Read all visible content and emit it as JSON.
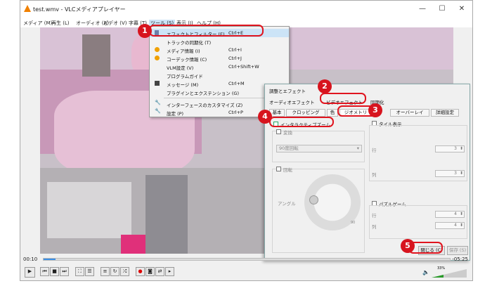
{
  "window": {
    "title": "test.wmv - VLCメディアプレイヤー"
  },
  "menubar": [
    {
      "label": "メディア (M)"
    },
    {
      "label": "再生 (L)"
    },
    {
      "label": "オーディオ (A)"
    },
    {
      "label": "ビデオ (V)"
    },
    {
      "label": "字幕 (T)"
    },
    {
      "label": "ツール (S)"
    },
    {
      "label": "表示 (I)"
    },
    {
      "label": "ヘルプ (H)"
    }
  ],
  "tools_menu": {
    "items": [
      {
        "label": "エフェクトとフィルター (E)",
        "shortcut": "Ctrl+E"
      },
      {
        "label": "トラックの同期化 (T)",
        "shortcut": ""
      },
      {
        "label": "メディア情報 (I)",
        "shortcut": "Ctrl+I"
      },
      {
        "label": "コーデック情報 (C)",
        "shortcut": "Ctrl+J"
      },
      {
        "label": "VLM設定 (V)",
        "shortcut": "Ctrl+Shift+W"
      },
      {
        "label": "プログラムガイド",
        "shortcut": ""
      },
      {
        "label": "メッセージ (M)",
        "shortcut": "Ctrl+M"
      },
      {
        "label": "プラグインとエクステンション (G)",
        "shortcut": ""
      },
      {
        "label": "インターフェースのカスタマイズ (Z)",
        "shortcut": ""
      },
      {
        "label": "設定 (P)",
        "shortcut": "Ctrl+P"
      }
    ]
  },
  "effects_dialog": {
    "title": "調整とエフェクト",
    "tabs": [
      {
        "label": "オーディオエフェクト"
      },
      {
        "label": "ビデオエフェクト"
      },
      {
        "label": "同期化"
      }
    ],
    "subtabs": [
      {
        "label": "基本"
      },
      {
        "label": "クロッピング"
      },
      {
        "label": "色"
      },
      {
        "label": "ジオメトリ"
      },
      {
        "label": "オーバーレイ"
      },
      {
        "label": "詳細設定"
      }
    ],
    "interactive_zoom": "インタラクティブズーム",
    "transform": "変換",
    "transform_value": "90度回転",
    "rotate": "回転",
    "angle": "アングル",
    "dial_mark": "90",
    "wall": "タイル表示",
    "rows": "行",
    "rows_value": "3",
    "cols": "列",
    "cols_value": "3",
    "puzzle": "パズルゲーム",
    "puzzle_rows": "行",
    "puzzle_rows_value": "4",
    "puzzle_cols": "列",
    "puzzle_cols_value": "4",
    "close_button": "閉じる (C)",
    "save_button": "保存 (S)"
  },
  "seek": {
    "elapsed": "00:10",
    "remaining": "-05:25",
    "progress": 0.03
  },
  "volume": {
    "label": "33%"
  },
  "badges": [
    "1",
    "2",
    "3",
    "4",
    "5"
  ],
  "colors": {
    "highlight": "#e0141e",
    "badge": "#d7141e",
    "menu_selected": "#cce4f7"
  }
}
